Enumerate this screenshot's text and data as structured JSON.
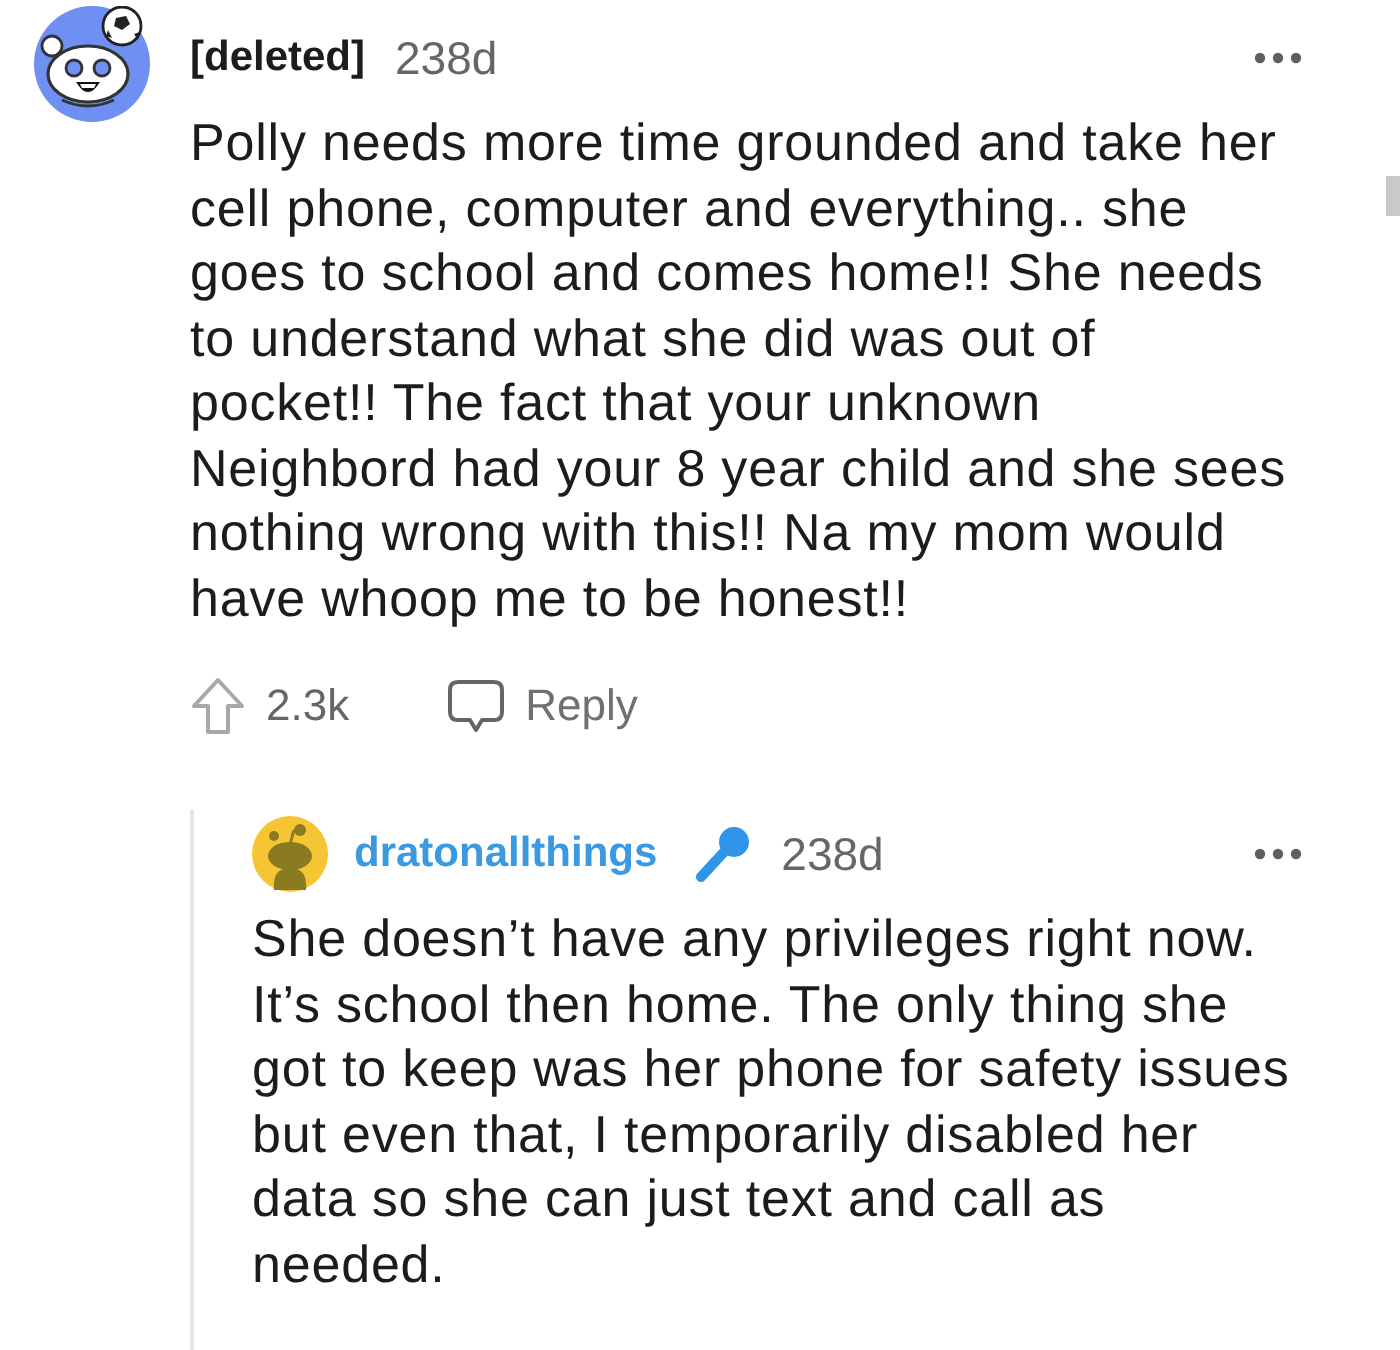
{
  "comments": [
    {
      "author": "[deleted]",
      "kind": "deleted",
      "age": "238d",
      "body_lines": [
        "Polly needs more time grounded and take her",
        "cell phone, computer and everything.. she",
        "goes to school and comes home!! She needs",
        "to understand what she did was out of",
        "pocket!! The fact that your unknown",
        "Neighbord had your 8 year child and she sees",
        "nothing wrong with this!! Na my mom would",
        "have whoop me to be honest!!"
      ],
      "actions": {
        "upvotes": "2.3k",
        "reply": "Reply"
      },
      "replies": [
        {
          "author": "dratonallthings",
          "kind": "user",
          "age": "238d",
          "badge": true,
          "body_lines": [
            "She doesn’t have any privileges right now.",
            "It’s school then home. The only thing she",
            "got to keep was her phone for safety issues",
            "but even that, I temporarily disabled her",
            "data so she can just text and call as",
            "needed."
          ]
        }
      ]
    }
  ]
}
